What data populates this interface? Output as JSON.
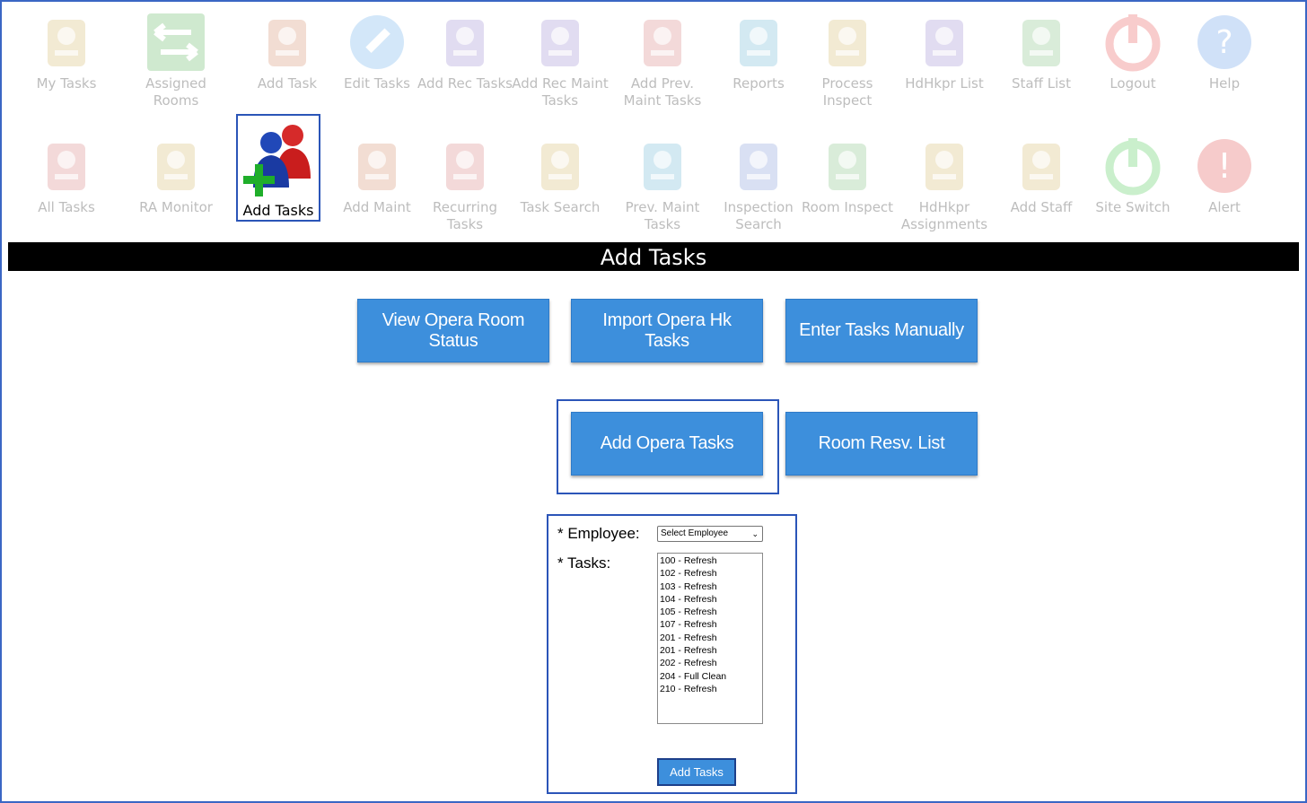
{
  "colors": {
    "accent": "#3d8fdc",
    "highlight": "#2b55b8",
    "title_bar": "#000000"
  },
  "nav": {
    "row1": [
      {
        "label": "My Tasks",
        "icon": "my-tasks-icon"
      },
      {
        "label": "Assigned Rooms",
        "icon": "assigned-rooms-icon"
      },
      {
        "label": "Add Task",
        "icon": "add-task-icon"
      },
      {
        "label": "Edit Tasks",
        "icon": "edit-tasks-icon"
      },
      {
        "label": "Add Rec Tasks",
        "icon": "add-rec-tasks-icon"
      },
      {
        "label": "Add Rec Maint Tasks",
        "icon": "add-rec-maint-tasks-icon"
      },
      {
        "label": "Add Prev. Maint Tasks",
        "icon": "add-prev-maint-tasks-icon"
      },
      {
        "label": "Reports",
        "icon": "reports-icon"
      },
      {
        "label": "Process Inspect",
        "icon": "process-inspect-icon"
      },
      {
        "label": "HdHkpr List",
        "icon": "hdhkpr-list-icon"
      },
      {
        "label": "Staff List",
        "icon": "staff-list-icon"
      },
      {
        "label": "Logout",
        "icon": "logout-icon"
      },
      {
        "label": "Help",
        "icon": "help-icon"
      }
    ],
    "row2": [
      {
        "label": "All Tasks",
        "icon": "all-tasks-icon"
      },
      {
        "label": "RA Monitor",
        "icon": "ra-monitor-icon"
      },
      {
        "label": "Add Tasks",
        "icon": "add-tasks-icon"
      },
      {
        "label": "Add Maint",
        "icon": "add-maint-icon"
      },
      {
        "label": "Recurring Tasks",
        "icon": "recurring-tasks-icon"
      },
      {
        "label": "Task Search",
        "icon": "task-search-icon"
      },
      {
        "label": "Prev. Maint Tasks",
        "icon": "prev-maint-tasks-icon"
      },
      {
        "label": "Inspection Search",
        "icon": "inspection-search-icon"
      },
      {
        "label": "Room Inspect",
        "icon": "room-inspect-icon"
      },
      {
        "label": "HdHkpr Assignments",
        "icon": "hdhkpr-assignments-icon"
      },
      {
        "label": "Add Staff",
        "icon": "add-staff-icon"
      },
      {
        "label": "Site Switch",
        "icon": "site-switch-icon"
      },
      {
        "label": "Alert",
        "icon": "alert-icon"
      }
    ]
  },
  "page_title": "Add Tasks",
  "actions": {
    "view_opera_room_status": "View Opera Room Status",
    "import_opera_hk_tasks": "Import Opera Hk Tasks",
    "enter_tasks_manually": "Enter Tasks Manually",
    "add_opera_tasks": "Add Opera Tasks",
    "room_resv_list": "Room Resv. List"
  },
  "form": {
    "employee_label": "* Employee:",
    "employee_value": "Select Employee",
    "tasks_label": "* Tasks:",
    "tasks": [
      "100 - Refresh",
      "102 - Refresh",
      "103 - Refresh",
      "104 - Refresh",
      "105 - Refresh",
      "107 - Refresh",
      "201 - Refresh",
      "201 - Refresh",
      "202 - Refresh",
      "204 - Full Clean",
      "210 - Refresh"
    ],
    "submit_label": "Add Tasks"
  }
}
